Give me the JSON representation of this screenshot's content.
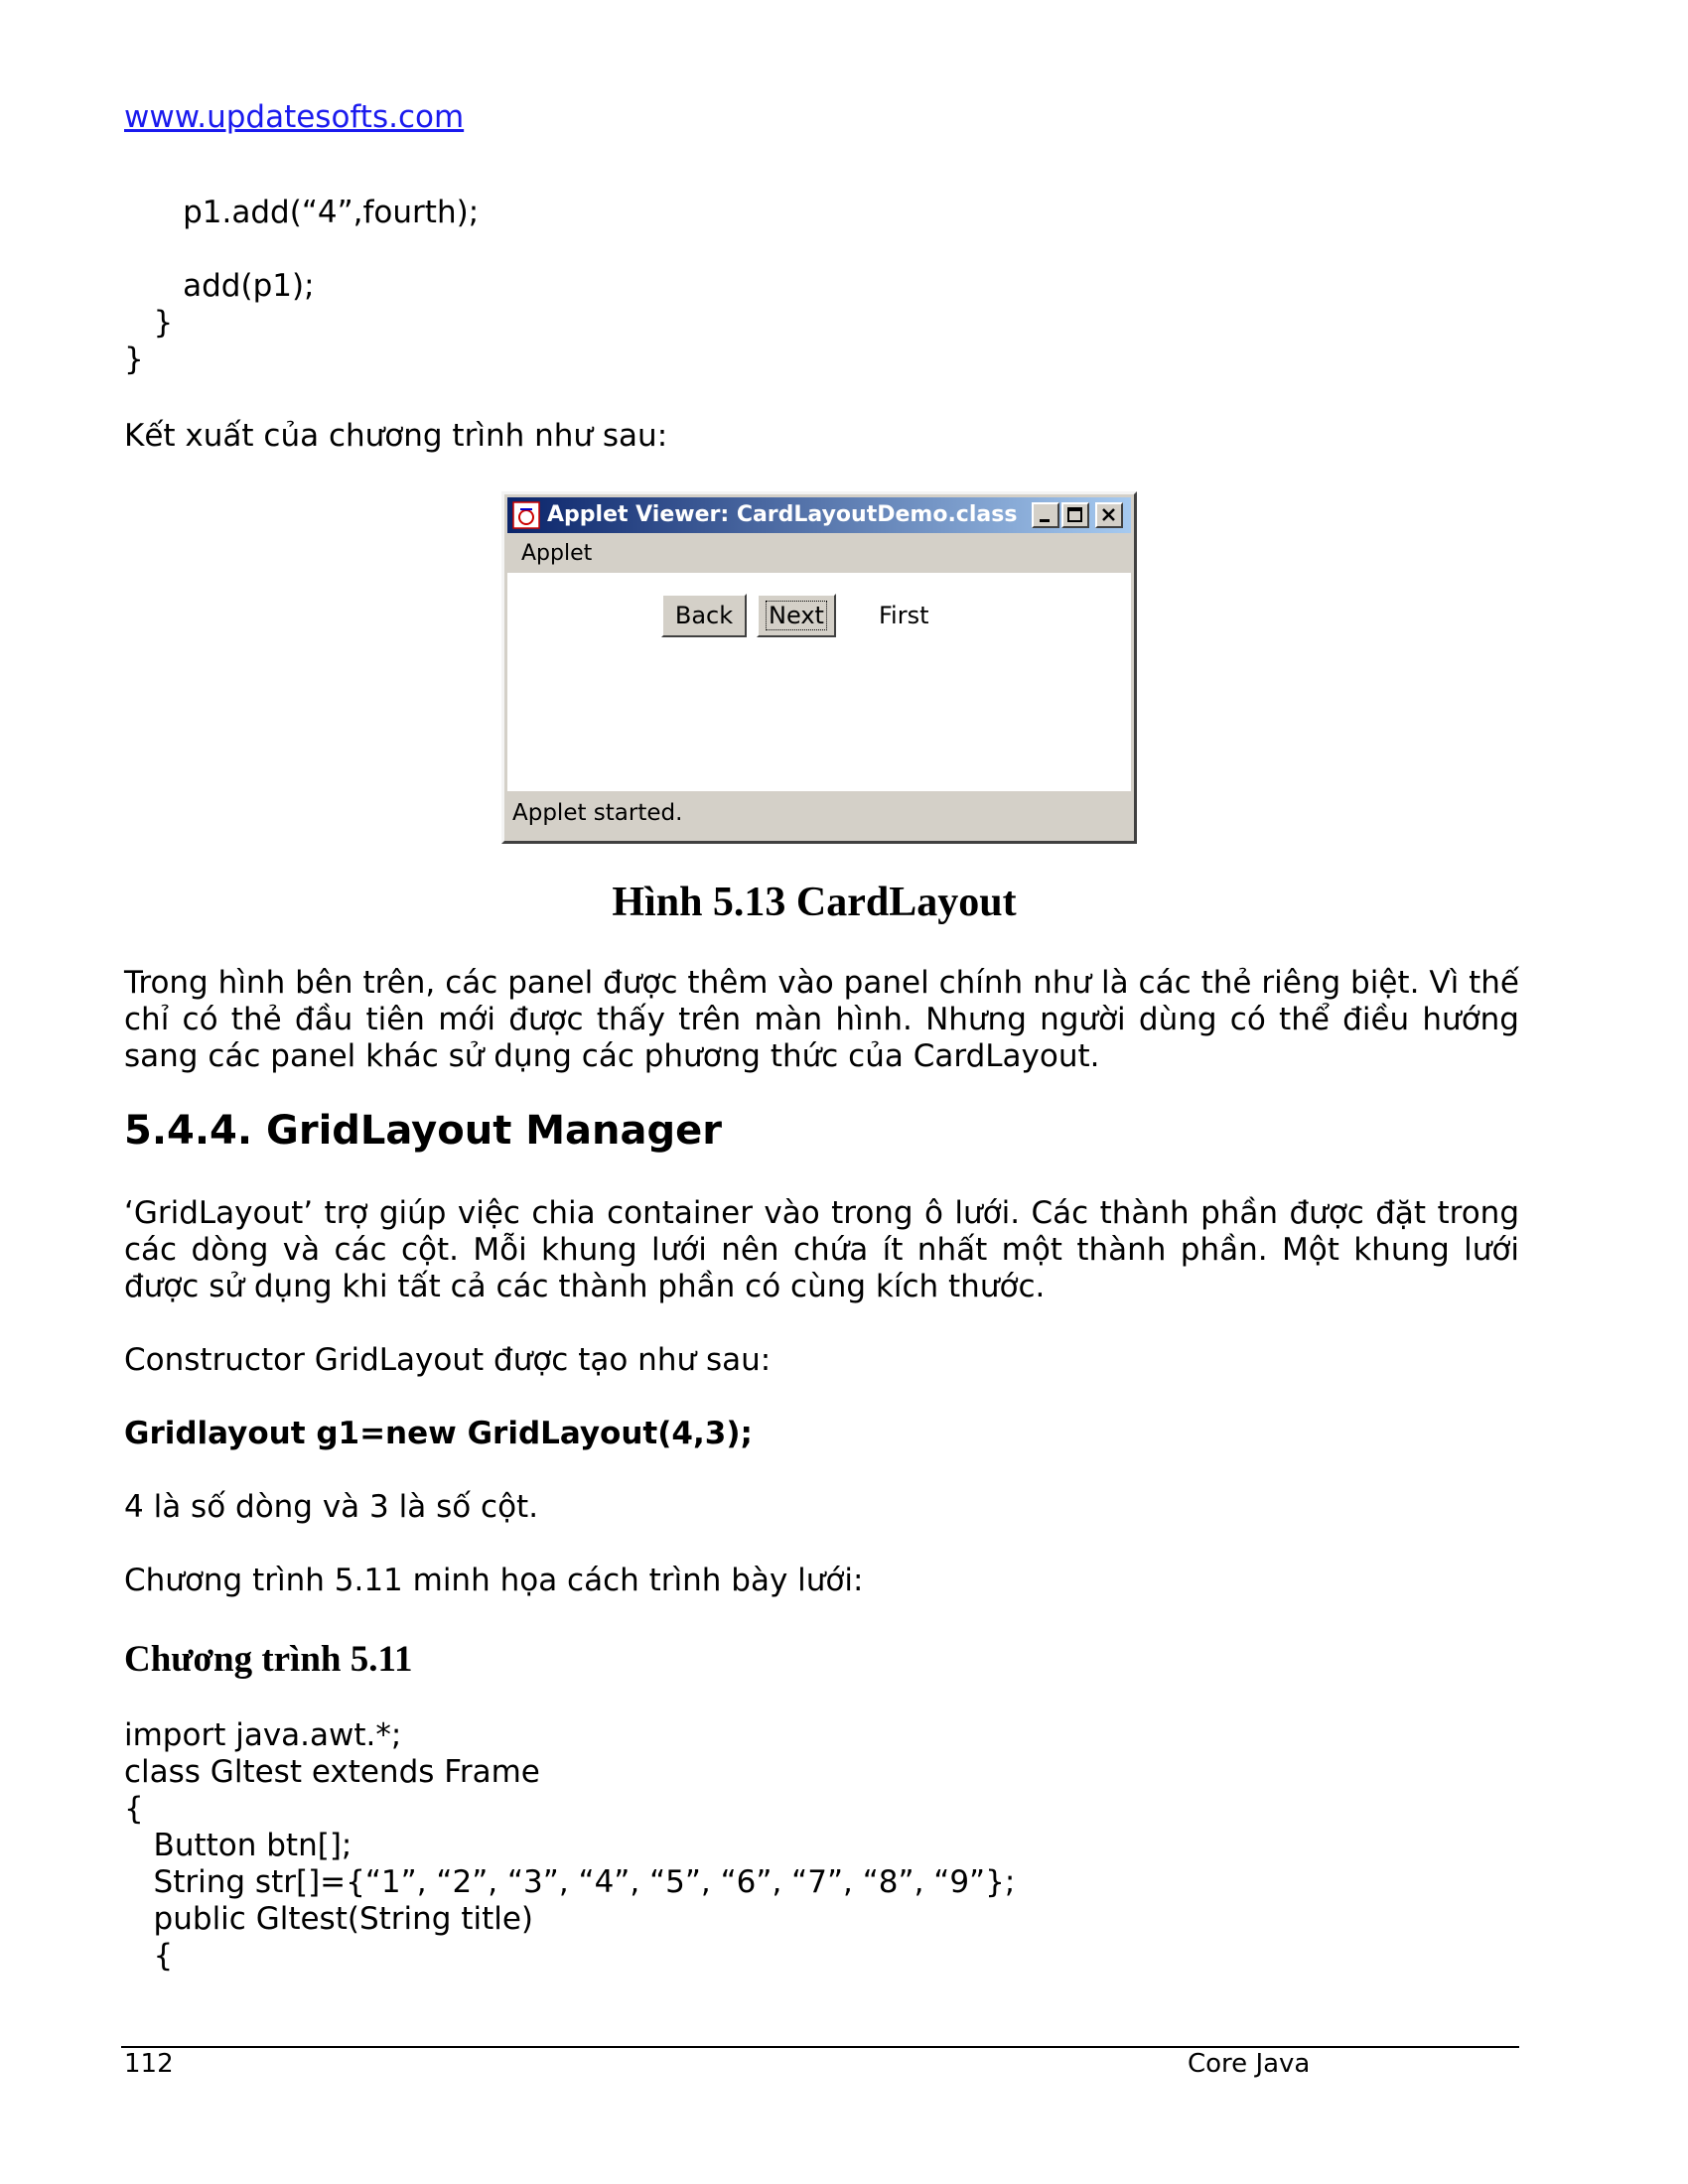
{
  "header": {
    "link": "www.updatesofts.com"
  },
  "code_top": [
    "      p1.add(“4”,fourth);",
    "",
    "      add(p1);",
    "   }",
    "}"
  ],
  "output_intro": "Kết xuất của chương trình như sau:",
  "applet_window": {
    "title": "Applet Viewer: CardLayoutDemo.class",
    "menu": "Applet",
    "back_button": "Back",
    "next_button": "Next",
    "card_label": "First",
    "status": "Applet started.",
    "colors": {
      "title_start": "#0a246a",
      "title_end": "#a6caf0",
      "face": "#d4d0c8"
    }
  },
  "figure_caption": "Hình 5.13 CardLayout",
  "paragraph1": "Trong hình bên trên, các panel được thêm vào panel chính như là các thẻ riêng biệt. Vì thế chỉ có thẻ đầu tiên mới được thấy trên màn hình. Nhưng người dùng có thể điều hướng sang các panel khác sử dụng các phương thức của CardLayout.",
  "section_heading": "5.4.4. GridLayout Manager",
  "paragraph2": "‘GridLayout’ trợ giúp việc chia container vào trong ô lưới. Các thành phần được đặt trong các dòng và các cột. Mỗi khung lưới nên chứa ít nhất một thành phần. Một khung lưới được sử dụng khi tất cả các thành phần có cùng kích thước.",
  "constructor_intro": "Constructor GridLayout được tạo như sau:",
  "constructor_code": "Gridlayout g1=new GridLayout(4,3);",
  "rows_cols_note": "4 là số dòng và 3 là số cột.",
  "program_intro": "Chương trình 5.11 minh họa cách trình bày lưới:",
  "program_heading": "Chương trình 5.11",
  "code_bottom": [
    "import java.awt.*;",
    "class Gltest extends Frame",
    "{",
    "   Button btn[];",
    "   String str[]={“1”, “2”, “3”, “4”, “5”, “6”, “7”, “8”, “9”};",
    "   public Gltest(String title)",
    "   {"
  ],
  "footer": {
    "page_number": "112",
    "book_title": "Core Java"
  }
}
